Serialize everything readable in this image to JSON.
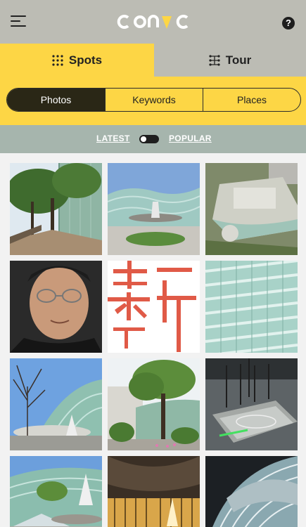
{
  "header": {
    "logo_text": "CONIC",
    "menu_icon": "hamburger-menu-icon",
    "help_label": "?"
  },
  "main_tabs": [
    {
      "label": "Spots",
      "icon": "dots-grid-icon",
      "active": true
    },
    {
      "label": "Tour",
      "icon": "route-grid-icon",
      "active": false
    }
  ],
  "segmented": [
    {
      "label": "Photos",
      "active": true
    },
    {
      "label": "Keywords",
      "active": false
    },
    {
      "label": "Places",
      "active": false
    }
  ],
  "sort": {
    "latest_label": "LATEST",
    "popular_label": "POPULAR",
    "selected": "LATEST"
  },
  "colors": {
    "header_bg": "#bcbcb4",
    "accent_yellow": "#fdd645",
    "sort_bar_bg": "#a6b5ad",
    "segment_active_bg": "#2a2716",
    "calligraphy_red": "#e05a47"
  },
  "photos": [
    {
      "subject": "wooded walkway with glass building"
    },
    {
      "subject": "museum exterior with circular plaza"
    },
    {
      "subject": "aerial view of building"
    },
    {
      "subject": "portrait of man with glasses"
    },
    {
      "subject": "red calligraphy characters"
    },
    {
      "subject": "glass facade close-up"
    },
    {
      "subject": "museum entrance with bare trees"
    },
    {
      "subject": "building with tree in front"
    },
    {
      "subject": "architectural model"
    },
    {
      "subject": "glass canopy and entrance"
    },
    {
      "subject": "museum at night"
    },
    {
      "subject": "curved glass facade from below"
    }
  ]
}
